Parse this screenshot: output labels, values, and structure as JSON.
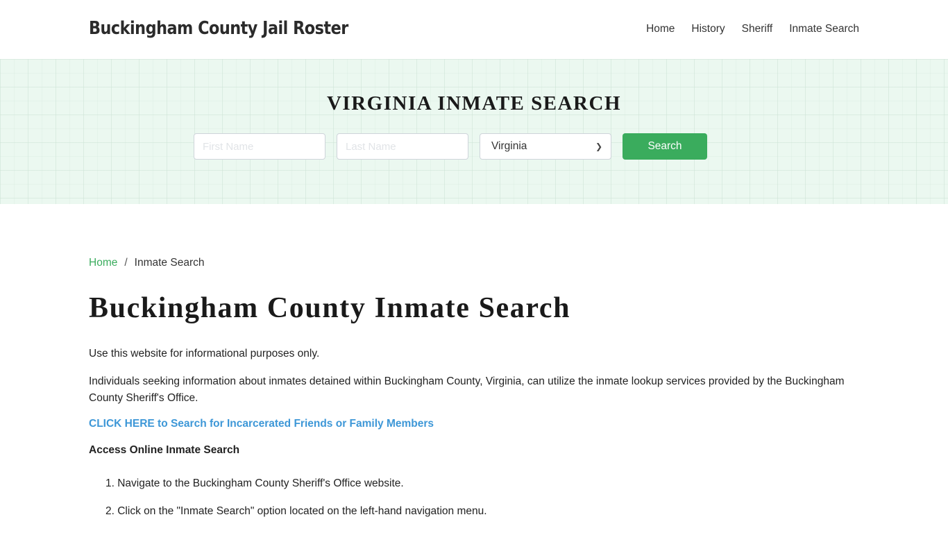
{
  "header": {
    "brand": "Buckingham County Jail Roster",
    "nav": [
      "Home",
      "History",
      "Sheriff",
      "Inmate Search"
    ]
  },
  "hero": {
    "title": "VIRGINIA INMATE SEARCH",
    "first_name_placeholder": "First Name",
    "last_name_placeholder": "Last Name",
    "state_selected": "Virginia",
    "search_label": "Search",
    "accent_color": "#3aac5d"
  },
  "breadcrumb": {
    "home": "Home",
    "separator": "/",
    "current": "Inmate Search"
  },
  "main": {
    "title": "Buckingham County Inmate Search",
    "paragraph1": "Use this website for informational purposes only.",
    "paragraph2": "Individuals seeking information about inmates detained within Buckingham County, Virginia, can utilize the inmate lookup services provided by the Buckingham County Sheriff's Office.",
    "cta_link": "CLICK HERE to Search for Incarcerated Friends or Family Members",
    "subheading": "Access Online Inmate Search",
    "steps": [
      "1. Navigate to the Buckingham County Sheriff's Office website.",
      "2. Click on the \"Inmate Search\" option located on the left-hand navigation menu."
    ]
  }
}
